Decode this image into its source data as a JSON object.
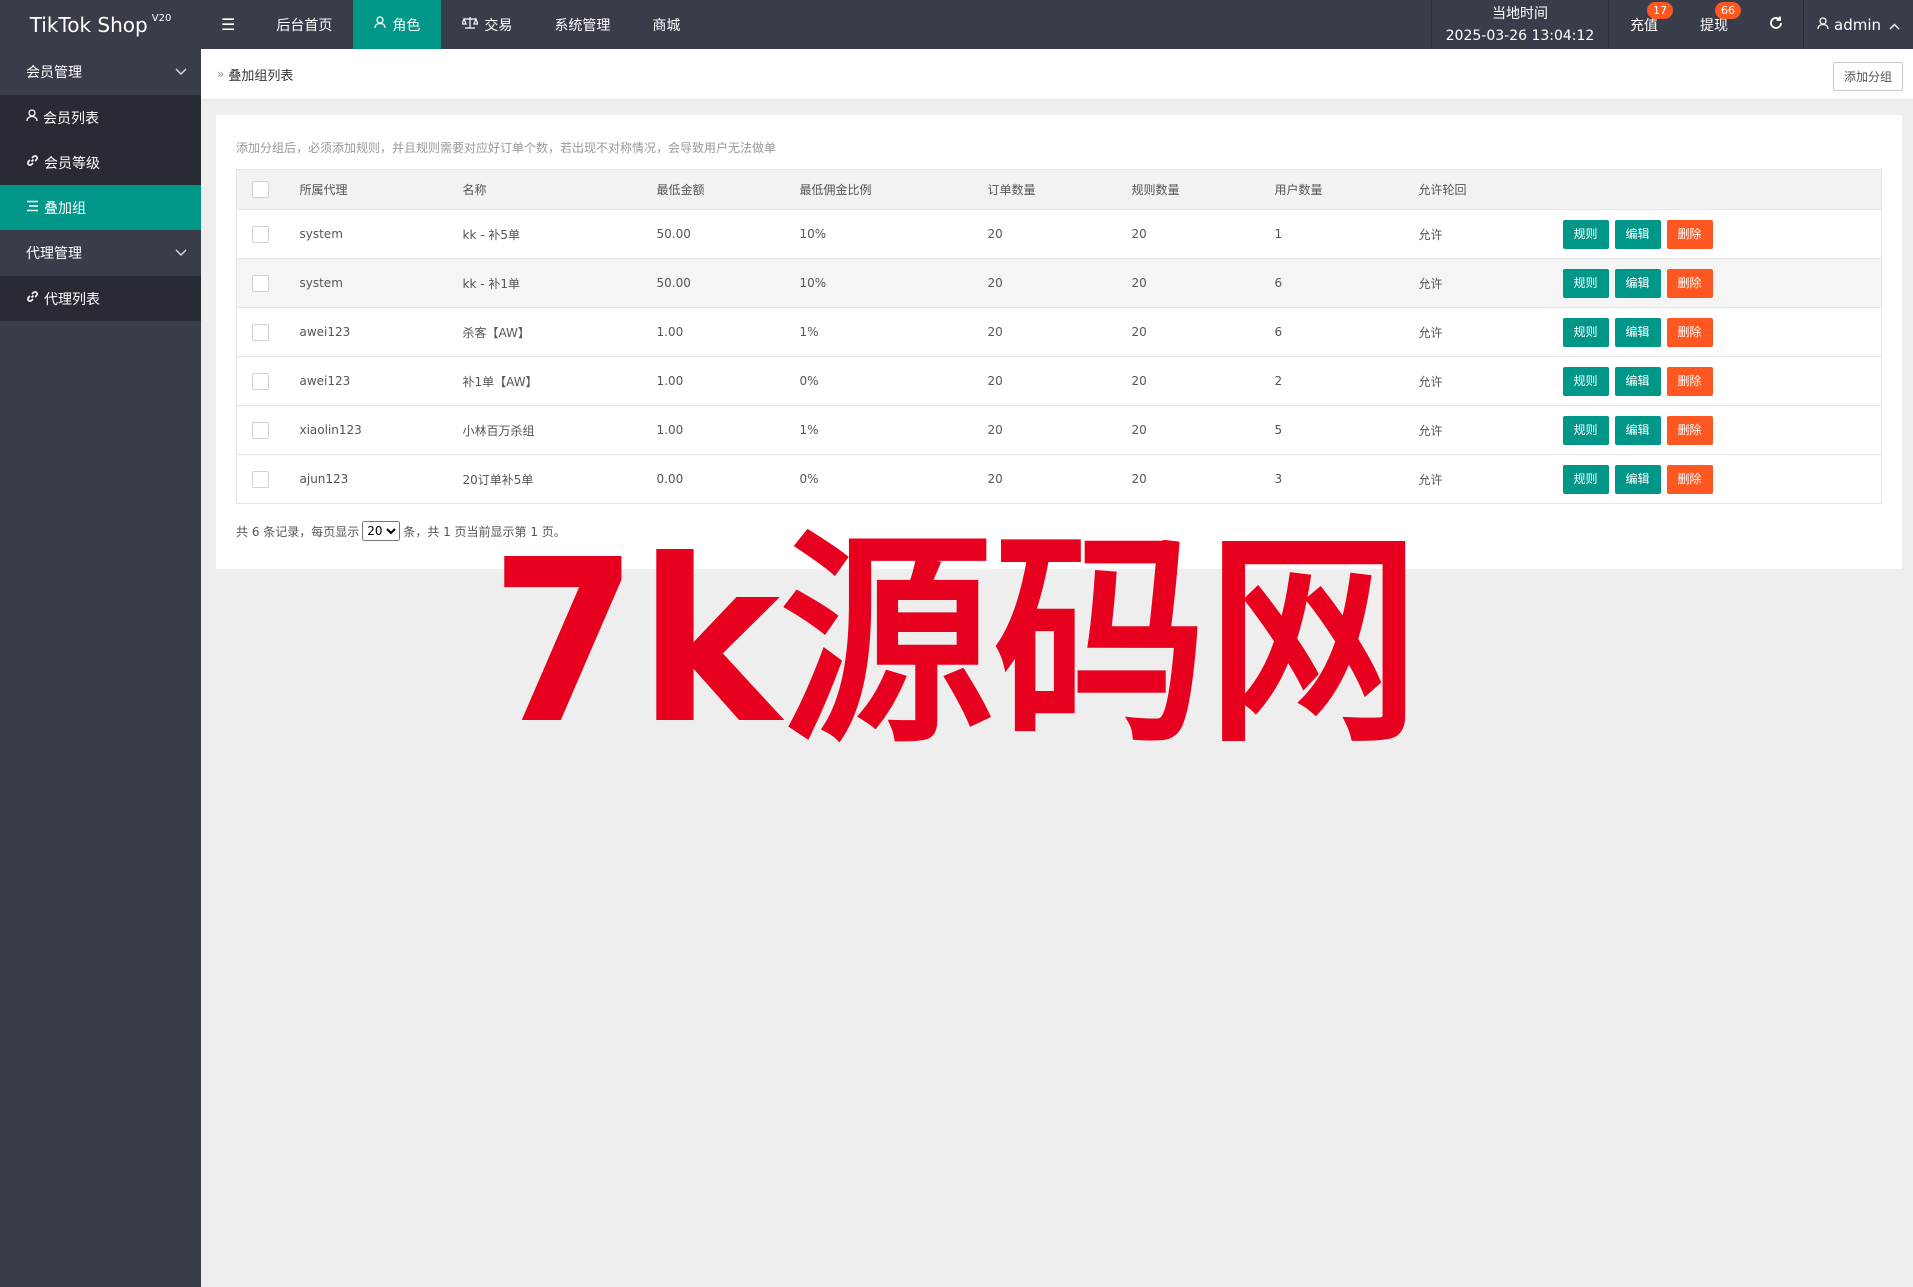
{
  "app": {
    "title": "TikTok Shop",
    "version": "V20"
  },
  "topnav": {
    "toggle": "☰",
    "items": [
      {
        "label": "后台首页"
      },
      {
        "label": "角色"
      },
      {
        "label": "交易"
      },
      {
        "label": "系统管理"
      },
      {
        "label": "商城"
      }
    ]
  },
  "topright": {
    "time_label": "当地时间",
    "time_value": "2025-03-26 13:04:12",
    "recharge_label": "充值",
    "recharge_badge": "17",
    "withdraw_label": "提现",
    "withdraw_badge": "66",
    "user": "admin"
  },
  "sidebar": {
    "groups": [
      {
        "label": "会员管理"
      },
      {
        "label": "代理管理"
      }
    ],
    "items": [
      {
        "label": "会员列表"
      },
      {
        "label": "会员等级"
      },
      {
        "label": "叠加组"
      },
      {
        "label": "代理列表"
      }
    ]
  },
  "breadcrumb": {
    "current": "叠加组列表",
    "add_button": "添加分组"
  },
  "page": {
    "hint": "添加分组后，必须添加规则，并且规则需要对应好订单个数，若出现不对称情况，会导致用户无法做单"
  },
  "table": {
    "headers": [
      "所属代理",
      "名称",
      "最低金额",
      "最低佣金比例",
      "订单数量",
      "规则数量",
      "用户数量",
      "允许轮回"
    ],
    "actions": {
      "rule": "规则",
      "edit": "编辑",
      "delete": "删除"
    },
    "rows": [
      {
        "agent": "system",
        "name": "kk - 补5单",
        "min_amount": "50.00",
        "min_rate": "10%",
        "orders": "20",
        "rules": "20",
        "users": "1",
        "cycle": "允许"
      },
      {
        "agent": "system",
        "name": "kk - 补1单",
        "min_amount": "50.00",
        "min_rate": "10%",
        "orders": "20",
        "rules": "20",
        "users": "6",
        "cycle": "允许"
      },
      {
        "agent": "awei123",
        "name": "杀客【AW】",
        "min_amount": "1.00",
        "min_rate": "1%",
        "orders": "20",
        "rules": "20",
        "users": "6",
        "cycle": "允许"
      },
      {
        "agent": "awei123",
        "name": "补1单【AW】",
        "min_amount": "1.00",
        "min_rate": "0%",
        "orders": "20",
        "rules": "20",
        "users": "2",
        "cycle": "允许"
      },
      {
        "agent": "xiaolin123",
        "name": "小林百万杀组",
        "min_amount": "1.00",
        "min_rate": "1%",
        "orders": "20",
        "rules": "20",
        "users": "5",
        "cycle": "允许"
      },
      {
        "agent": "ajun123",
        "name": "20订单补5单",
        "min_amount": "0.00",
        "min_rate": "0%",
        "orders": "20",
        "rules": "20",
        "users": "3",
        "cycle": "允许"
      }
    ]
  },
  "pager": {
    "prefix": "共 6 条记录，每页显示",
    "page_size": "20",
    "suffix": "条，共 1 页当前显示第 1 页。"
  },
  "watermark": {
    "text": "7k源码网",
    "color": "#e8001f"
  }
}
